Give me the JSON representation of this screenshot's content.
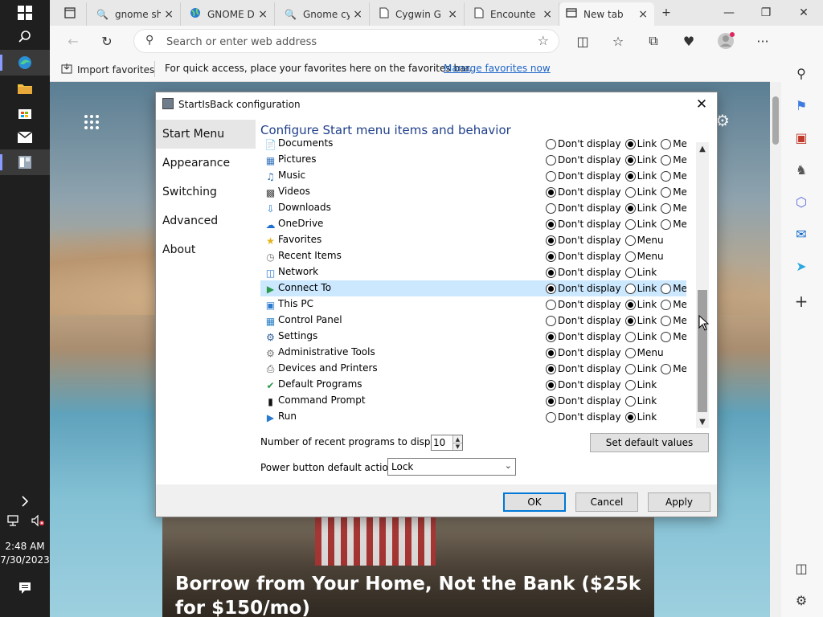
{
  "taskbar": {
    "time": "2:48 AM",
    "date": "7/30/2023"
  },
  "browser": {
    "tabs": [
      {
        "title": "gnome sh",
        "icon": "search-icon"
      },
      {
        "title": "GNOME D",
        "icon": "globe-icon"
      },
      {
        "title": "Gnome cy",
        "icon": "search-icon"
      },
      {
        "title": "Cygwin G",
        "icon": "document-icon"
      },
      {
        "title": "Encounte",
        "icon": "document-icon"
      },
      {
        "title": "New tab",
        "icon": "new-tab-icon"
      }
    ],
    "address_placeholder": "Search or enter web address",
    "favbar": {
      "import_label": "Import favorites",
      "hint": "For quick access, place your favorites here on the favorites bar.",
      "manage_link": "Manage favorites now"
    },
    "news_headline": "Borrow from Your Home, Not the Bank ($25k for $150/mo)"
  },
  "dialog": {
    "title": "StartIsBack configuration",
    "nav": [
      "Start Menu",
      "Appearance",
      "Switching",
      "Advanced",
      "About"
    ],
    "selected_nav": "Start Menu",
    "heading": "Configure Start menu items and behavior",
    "items": [
      {
        "label": "Documents",
        "icon": "documents-icon",
        "options": [
          "Don't display",
          "Link",
          "Menu"
        ],
        "selected": 1
      },
      {
        "label": "Pictures",
        "icon": "pictures-icon",
        "options": [
          "Don't display",
          "Link",
          "Menu"
        ],
        "selected": 1
      },
      {
        "label": "Music",
        "icon": "music-icon",
        "options": [
          "Don't display",
          "Link",
          "Menu"
        ],
        "selected": 1
      },
      {
        "label": "Videos",
        "icon": "videos-icon",
        "options": [
          "Don't display",
          "Link",
          "Menu"
        ],
        "selected": 0
      },
      {
        "label": "Downloads",
        "icon": "downloads-icon",
        "options": [
          "Don't display",
          "Link",
          "Menu"
        ],
        "selected": 1
      },
      {
        "label": "OneDrive",
        "icon": "onedrive-icon",
        "options": [
          "Don't display",
          "Link",
          "Menu"
        ],
        "selected": 0
      },
      {
        "label": "Favorites",
        "icon": "favorites-star-icon",
        "options": [
          "Don't display",
          "Menu"
        ],
        "selected": 0
      },
      {
        "label": "Recent Items",
        "icon": "recent-items-icon",
        "options": [
          "Don't display",
          "Menu"
        ],
        "selected": 0
      },
      {
        "label": "Network",
        "icon": "network-icon",
        "options": [
          "Don't display",
          "Link"
        ],
        "selected": 0
      },
      {
        "label": "Connect To",
        "icon": "connect-to-icon",
        "options": [
          "Don't display",
          "Link",
          "Menu"
        ],
        "selected": 0,
        "highlighted": true
      },
      {
        "label": "This PC",
        "icon": "this-pc-icon",
        "options": [
          "Don't display",
          "Link",
          "Menu"
        ],
        "selected": 1
      },
      {
        "label": "Control Panel",
        "icon": "control-panel-icon",
        "options": [
          "Don't display",
          "Link",
          "Menu"
        ],
        "selected": 1
      },
      {
        "label": "Settings",
        "icon": "settings-gear-icon",
        "options": [
          "Don't display",
          "Link",
          "Menu"
        ],
        "selected": 0
      },
      {
        "label": "Administrative Tools",
        "icon": "admin-tools-icon",
        "options": [
          "Don't display",
          "Menu"
        ],
        "selected": 0
      },
      {
        "label": "Devices and Printers",
        "icon": "devices-printers-icon",
        "options": [
          "Don't display",
          "Link",
          "Menu"
        ],
        "selected": 0
      },
      {
        "label": "Default Programs",
        "icon": "default-programs-icon",
        "options": [
          "Don't display",
          "Link"
        ],
        "selected": 0
      },
      {
        "label": "Command Prompt",
        "icon": "command-prompt-icon",
        "options": [
          "Don't display",
          "Link"
        ],
        "selected": 0
      },
      {
        "label": "Run",
        "icon": "run-icon",
        "options": [
          "Don't display",
          "Link"
        ],
        "selected": 1
      }
    ],
    "recent_label": "Number of recent programs to display:",
    "recent_value": "10",
    "set_defaults_label": "Set default values",
    "power_label": "Power button default action:",
    "power_value": "Lock",
    "buttons": {
      "ok": "OK",
      "cancel": "Cancel",
      "apply": "Apply"
    }
  }
}
